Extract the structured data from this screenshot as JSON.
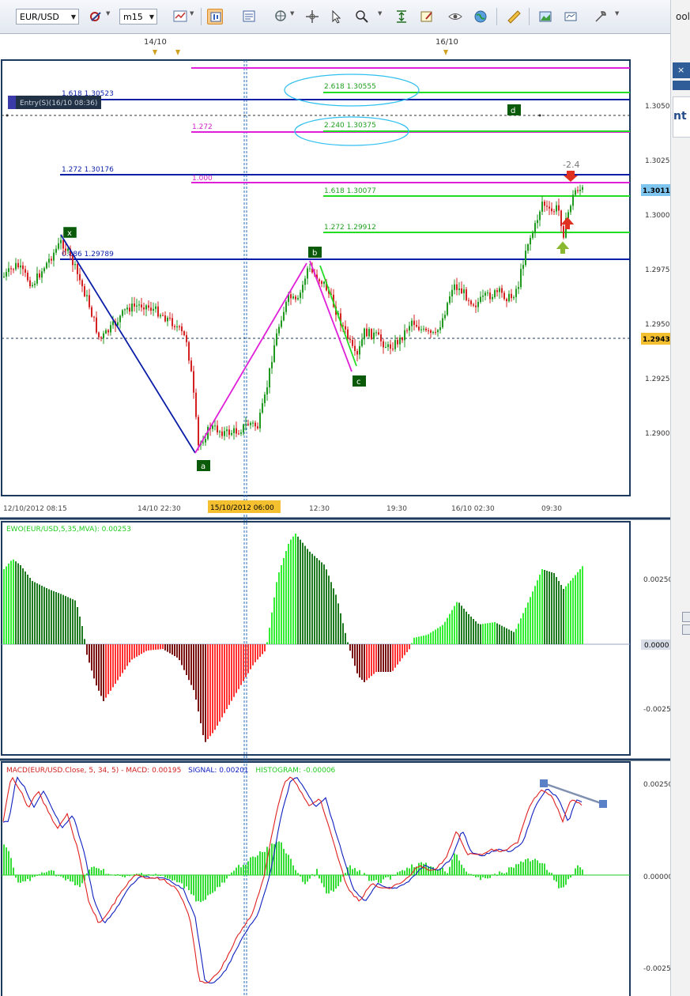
{
  "toolbar": {
    "symbol": "EUR/USD",
    "timeframe": "m15",
    "tools_label": "ools"
  },
  "side_panel": {
    "close_glyph": "×",
    "text": "nt"
  },
  "chart": {
    "top_dates": [
      "14/10",
      "16/10"
    ],
    "price_ticks": [
      "1.3050",
      "1.3025",
      "1.3000",
      "1.2975",
      "1.2950",
      "1.2925",
      "1.2900"
    ],
    "price_badges": {
      "last": "1.30110",
      "entry": "1.29430"
    },
    "time_labels": [
      "12/10/2012 08:15",
      "14/10 22:30",
      "12:30",
      "19:30",
      "16/10 02:30",
      "09:30"
    ],
    "crosshair_time": "15/10/2012 06:00",
    "fib_labels": {
      "f1618_left": "1.618 1.30523",
      "f2618": "2.618 1.30555",
      "f1272_mid": "1.272",
      "f2240": "2.240 1.30375",
      "f1272_left": "1.272 1.30176",
      "f1000": "1.000",
      "f1618_right": "1.618 1.30077",
      "f1272_right": "1.272 1.29912",
      "f0886": "0.886 1.29789"
    },
    "entry_label": "Entry(S)(16/10 08:36)",
    "wave_labels": {
      "x": "x",
      "a": "a",
      "b": "b",
      "c": "c",
      "d": "d"
    },
    "trade_value": "-2.4",
    "colors": {
      "bull": "#1f9a1f",
      "bear": "#d42020",
      "fib_blue": "#0a1ea8",
      "fib_magenta": "#e020d8",
      "fib_green": "#22dd22"
    }
  },
  "ewo": {
    "title": "EWO(EUR/USD,5,35,MVA): 0.00253",
    "ticks": [
      "0.00250",
      "0.0000",
      "-0.0025"
    ]
  },
  "macd": {
    "title_part1": "MACD(EUR/USD.Close, 5, 34, 5) -   MACD: 0.00195",
    "title_signal": "SIGNAL: 0.00201",
    "title_hist": "HISTOGRAM: -0.00006",
    "ticks": [
      "0.00250",
      "0.00000",
      "-0.0025"
    ]
  },
  "chart_data": {
    "type": "line",
    "title": "",
    "instrument": "EUR/USD",
    "timeframe": "m15",
    "price_axis_ticks": [
      1.305,
      1.3025,
      1.3,
      1.2975,
      1.295,
      1.2925,
      1.29
    ],
    "price_range": [
      1.288,
      1.3065
    ],
    "last_price": 1.3011,
    "entry_price": 1.2943,
    "fib_levels": [
      1.30523,
      1.30555,
      1.30375,
      1.30176,
      1.30077,
      1.29912,
      1.29789
    ],
    "series": [
      {
        "name": "Close",
        "x": [
          "12/10/2012 08:15",
          "14/10 22:30",
          "15/10/2012 06:00",
          "12:30",
          "19:30",
          "16/10 02:30",
          "09:30"
        ],
        "values": [
          1.2972,
          1.2958,
          1.2905,
          1.2966,
          1.294,
          1.2968,
          1.3011
        ]
      },
      {
        "name": "EWO",
        "values": [
          0.0019,
          0.0001,
          -0.0027,
          0.0012,
          -0.0009,
          0.0006,
          0.0025
        ]
      },
      {
        "name": "MACD",
        "values": [
          0.0026,
          0.0009,
          -0.0028,
          0.0024,
          -0.0002,
          0.0004,
          0.0019
        ]
      }
    ],
    "grid": false,
    "legend": "none"
  }
}
